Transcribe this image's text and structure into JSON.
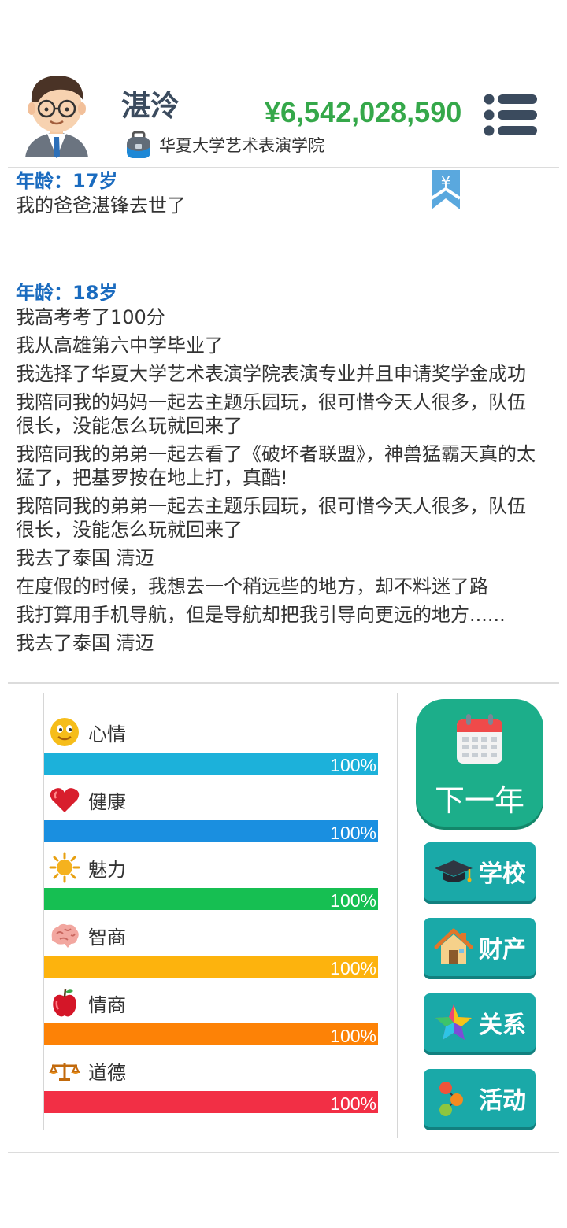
{
  "profile": {
    "name": "湛泠",
    "school": "华夏大学艺术表演学院",
    "money": "¥6,542,028,590"
  },
  "log": {
    "bookmark_symbol": "¥",
    "entries": [
      {
        "age": "年龄：17岁",
        "lines": [
          "我的爸爸湛锋去世了"
        ]
      },
      {
        "age": "年龄：18岁",
        "lines": [
          "我高考考了100分",
          "我从高雄第六中学毕业了",
          "我选择了华夏大学艺术表演学院表演专业并且申请奖学金成功",
          "我陪同我的妈妈一起去主题乐园玩，很可惜今天人很多，队伍很长，没能怎么玩就回来了",
          "我陪同我的弟弟一起去看了《破坏者联盟》，神兽猛霸天真的太猛了，把基罗按在地上打，真酷!",
          "我陪同我的弟弟一起去主题乐园玩，很可惜今天人很多，队伍很长，没能怎么玩就回来了",
          "我去了泰国 清迈",
          "在度假的时候，我想去一个稍远些的地方，却不料迷了路",
          "我打算用手机导航，但是导航却把我引导向更远的地方......",
          "我去了泰国 清迈"
        ]
      }
    ]
  },
  "stats": [
    {
      "name": "心情",
      "icon": "smiley-icon",
      "value": 100,
      "label": "100%",
      "color": "#1cb1da"
    },
    {
      "name": "健康",
      "icon": "heart-icon",
      "value": 100,
      "label": "100%",
      "color": "#1a8fe0"
    },
    {
      "name": "魅力",
      "icon": "sun-icon",
      "value": 100,
      "label": "100%",
      "color": "#16bf52"
    },
    {
      "name": "智商",
      "icon": "brain-icon",
      "value": 100,
      "label": "100%",
      "color": "#fdb30d"
    },
    {
      "name": "情商",
      "icon": "apple-icon",
      "value": 100,
      "label": "100%",
      "color": "#fd8206"
    },
    {
      "name": "道德",
      "icon": "scales-icon",
      "value": 100,
      "label": "100%",
      "color": "#f22f45"
    }
  ],
  "actions": {
    "next_year": "下一年",
    "school": "学校",
    "property": "财产",
    "relations": "关系",
    "activities": "活动"
  },
  "colors": {
    "next_year_bg": "#1cae8a",
    "action_bg": "#1aa9a8",
    "age_text": "#1a6bbf",
    "money_text": "#35a84a"
  }
}
